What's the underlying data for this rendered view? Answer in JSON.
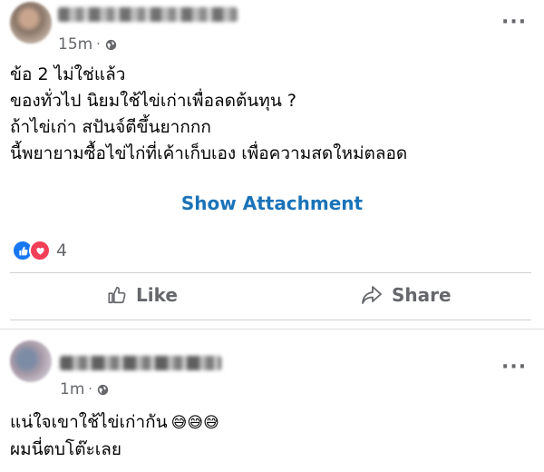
{
  "posts": [
    {
      "time": "15m",
      "privacy_icon": "globe-icon",
      "lines": [
        "ข้อ 2 ไม่ใช่แล้ว",
        "ของทั่วไป นิยมใช้ไข่เก่าเพื่อลดต้นทุน ?",
        "ถ้าไข่เก่า สปันจ์ตีขึ้นยากกก",
        "นี้พยายามซื้อไข่ไก่ที่เค้าเก็บเอง เพื่อความสดใหม่ตลอด"
      ],
      "attachment_label": "Show Attachment",
      "reaction_count": "4",
      "actions": {
        "like": "Like",
        "share": "Share"
      }
    },
    {
      "time": "1m",
      "privacy_icon": "globe-icon",
      "lines": [
        "แน่ใจเขาใช้ไข่เก่ากัน",
        "ผมนี่ตบโต๊ะเลย"
      ],
      "emoji": "😅😅😅"
    }
  ],
  "colors": {
    "link": "#1a73b8",
    "meta": "#65676b",
    "like_reaction": "#1877f2",
    "love_reaction": "#f33e58"
  }
}
